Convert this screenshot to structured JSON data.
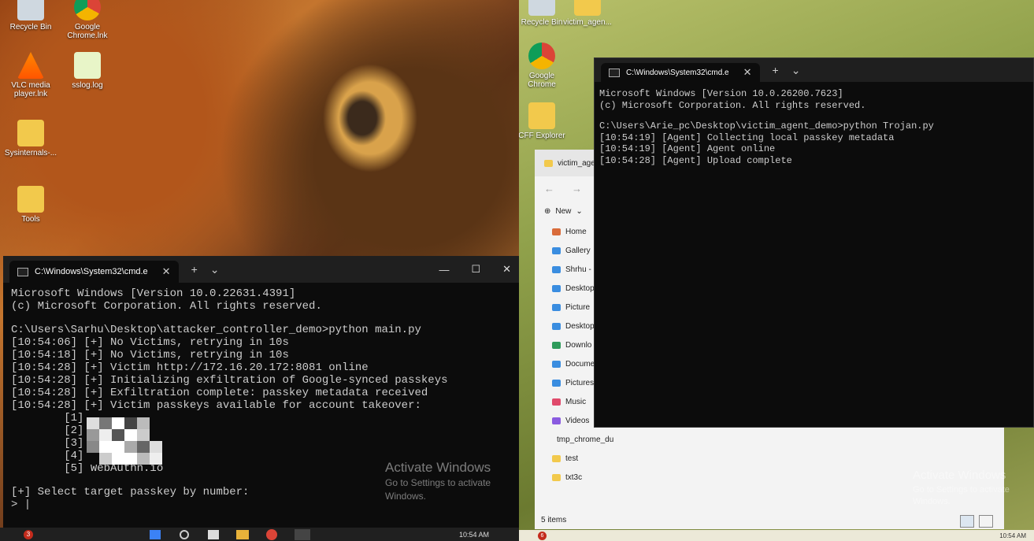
{
  "left_desktop": {
    "icons": [
      {
        "label": "Recycle Bin",
        "icon": "recycle-bin-icon"
      },
      {
        "label": "Google Chrome.lnk",
        "icon": "chrome-icon"
      },
      {
        "label": "VLC media player.lnk",
        "icon": "vlc-icon"
      },
      {
        "label": "sslog.log",
        "icon": "log-file-icon"
      },
      {
        "label": "Sysinternals-...",
        "icon": "folder-icon"
      },
      {
        "label": "Tools",
        "icon": "folder-icon"
      }
    ],
    "cmd": {
      "tab_title": "C:\\Windows\\System32\\cmd.e",
      "lines": [
        "Microsoft Windows [Version 10.0.22631.4391]",
        "(c) Microsoft Corporation. All rights reserved.",
        "",
        "C:\\Users\\Sarhu\\Desktop\\attacker_controller_demo>python main.py",
        "[10:54:06] [+] No Victims, retrying in 10s",
        "[10:54:18] [+] No Victims, retrying in 10s",
        "[10:54:28] [+] Victim http://172.16.20.172:8081 online",
        "[10:54:28] [+] Initializing exfiltration of Google-synced passkeys",
        "[10:54:28] [+] Exfiltration complete: passkey metadata received",
        "[10:54:28] [+] Victim passkeys available for account takeover:",
        "        [1]",
        "        [2]",
        "        [3]",
        "        [4]",
        "        [5] WebAuthn.io",
        "",
        "[+] Select target passkey by number:",
        "> |"
      ]
    },
    "watermark": {
      "title": "Activate Windows",
      "line1": "Go to Settings to activate",
      "line2": "Windows."
    },
    "taskbar": {
      "badge": "3",
      "time": "10:54 AM"
    }
  },
  "right_desktop": {
    "icons": [
      {
        "label": "Recycle Bin",
        "icon": "recycle-bin-icon"
      },
      {
        "label": "victim_agen...",
        "icon": "folder-icon"
      },
      {
        "label": "Google Chrome",
        "icon": "chrome-icon"
      },
      {
        "label": "CFF Explorer",
        "icon": "folder-icon"
      }
    ],
    "cmd": {
      "tab_title": "C:\\Windows\\System32\\cmd.e",
      "lines": [
        "Microsoft Windows [Version 10.0.26200.7623]",
        "(c) Microsoft Corporation. All rights reserved.",
        "",
        "C:\\Users\\Arie_pc\\Desktop\\victim_agent_demo>python Trojan.py",
        "[10:54:19] [Agent] Collecting local passkey metadata",
        "[10:54:19] [Agent] Agent online",
        "[10:54:28] [Agent] Upload complete"
      ]
    },
    "explorer": {
      "tab_title": "victim_age",
      "new_label": "New",
      "nav": [
        {
          "label": "Home",
          "icon": "home-icon"
        },
        {
          "label": "Gallery",
          "icon": "gallery-icon"
        },
        {
          "label": "Shrhu - P",
          "icon": "cloud-icon"
        },
        {
          "label": "Desktop",
          "icon": "desktop-icon"
        },
        {
          "label": "Picture",
          "icon": "pictures-icon"
        },
        {
          "label": "Desktop",
          "icon": "desktop-icon"
        },
        {
          "label": "Downlo",
          "icon": "download-icon"
        },
        {
          "label": "Docume",
          "icon": "document-icon"
        },
        {
          "label": "Pictures",
          "icon": "pictures-icon"
        },
        {
          "label": "Music",
          "icon": "music-icon"
        },
        {
          "label": "Videos",
          "icon": "videos-icon"
        },
        {
          "label": "tmp_chrome_du",
          "icon": "folder-icon"
        },
        {
          "label": "test",
          "icon": "folder-icon"
        },
        {
          "label": "txt3c",
          "icon": "folder-icon"
        }
      ],
      "status": "5 items"
    },
    "watermark": {
      "title": "Activate Windows",
      "line1": "Go to Settings to activate",
      "line2": "Windows."
    },
    "taskbar": {
      "badge": "6",
      "time": "10:54 AM"
    }
  }
}
